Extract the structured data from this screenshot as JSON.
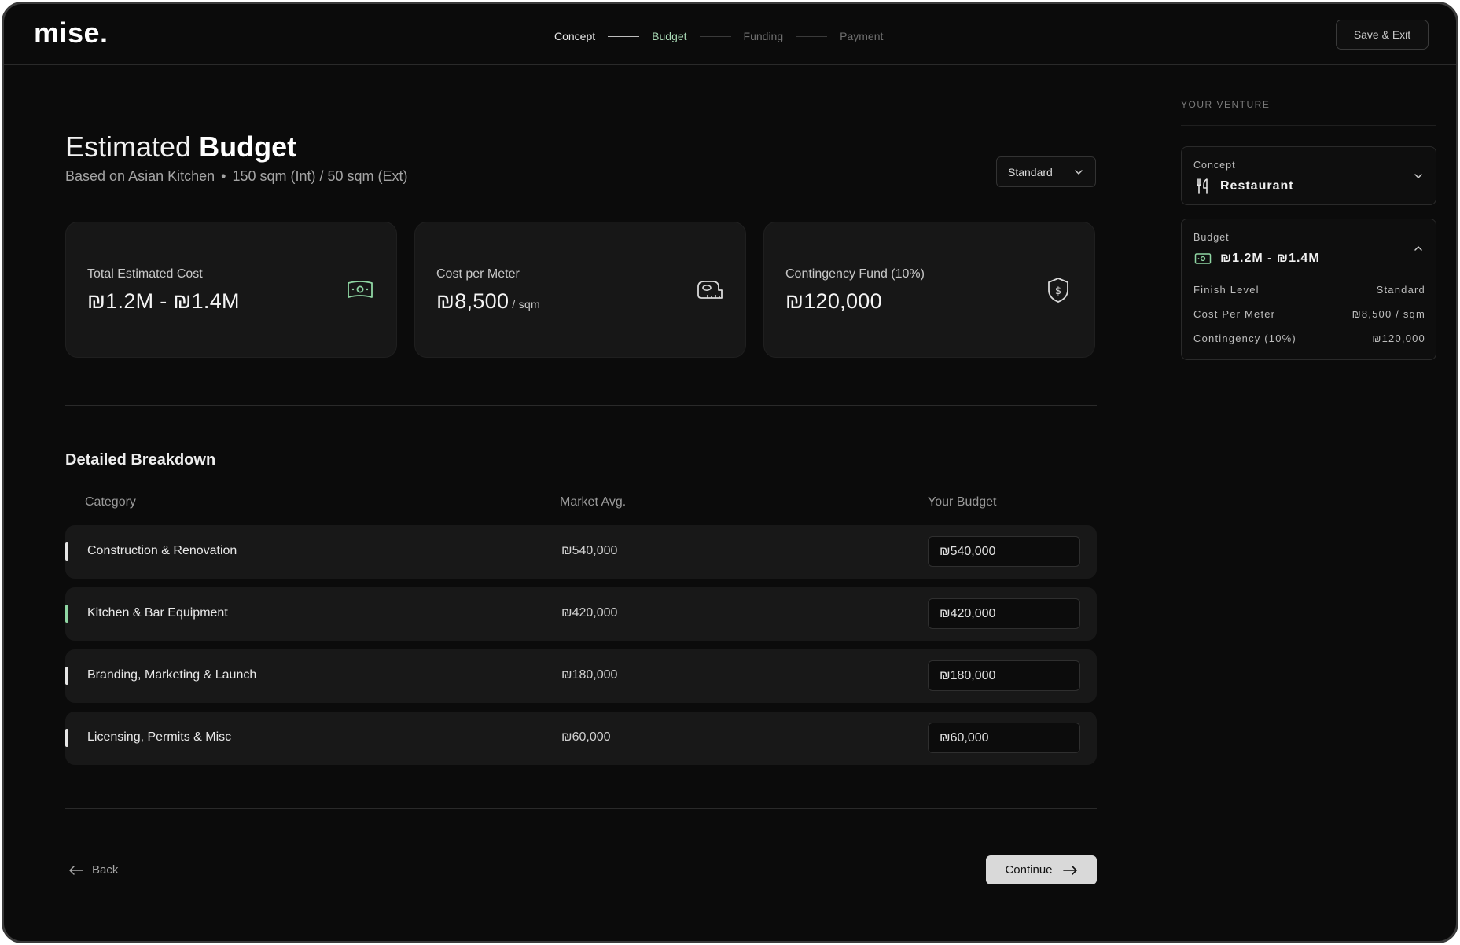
{
  "app": {
    "logo": "mise."
  },
  "steps": [
    {
      "label": "Concept",
      "state": "done"
    },
    {
      "label": "Budget",
      "state": "current"
    },
    {
      "label": "Funding",
      "state": "todo"
    },
    {
      "label": "Payment",
      "state": "todo"
    }
  ],
  "header": {
    "save_exit": "Save & Exit"
  },
  "page": {
    "title_light": "Estimated",
    "title_bold": "Budget",
    "subtitle_a": "Based on Asian Kitchen",
    "subtitle_dot": "•",
    "subtitle_b": "150 sqm (Int) / 50 sqm (Ext)",
    "finish_select": "Standard"
  },
  "cards": [
    {
      "label": "Total Estimated Cost",
      "value": "₪1.2M - ₪1.4M",
      "unit": "",
      "icon": "cash-icon"
    },
    {
      "label": "Cost per Meter",
      "value": "₪8,500",
      "unit": "/ sqm",
      "icon": "tape-measure-icon"
    },
    {
      "label": "Contingency Fund (10%)",
      "value": "₪120,000",
      "unit": "",
      "icon": "shield-dollar-icon"
    }
  ],
  "breakdown": {
    "title": "Detailed Breakdown",
    "columns": {
      "category": "Category",
      "market": "Market Avg.",
      "budget": "Your Budget"
    },
    "rows": [
      {
        "category": "Construction & Renovation",
        "market": "₪540,000",
        "budget": "₪540,000"
      },
      {
        "category": "Kitchen & Bar Equipment",
        "market": "₪420,000",
        "budget": "₪420,000"
      },
      {
        "category": "Branding, Marketing & Launch",
        "market": "₪180,000",
        "budget": "₪180,000"
      },
      {
        "category": "Licensing, Permits & Misc",
        "market": "₪60,000",
        "budget": "₪60,000"
      }
    ]
  },
  "nav": {
    "back": "Back",
    "continue": "Continue"
  },
  "sidebar": {
    "heading": "YOUR VENTURE",
    "concept": {
      "key": "Concept",
      "value": "Restaurant"
    },
    "budget": {
      "key": "Budget",
      "value": "₪1.2M - ₪1.4M",
      "rows": [
        {
          "k": "Finish Level",
          "v": "Standard"
        },
        {
          "k": "Cost Per Meter",
          "v": "₪8,500 / sqm"
        },
        {
          "k": "Contingency (10%)",
          "v": "₪120,000"
        }
      ]
    }
  },
  "colors": {
    "accent": "#8fd6a3",
    "background": "#0b0b0b",
    "card": "#171717"
  }
}
